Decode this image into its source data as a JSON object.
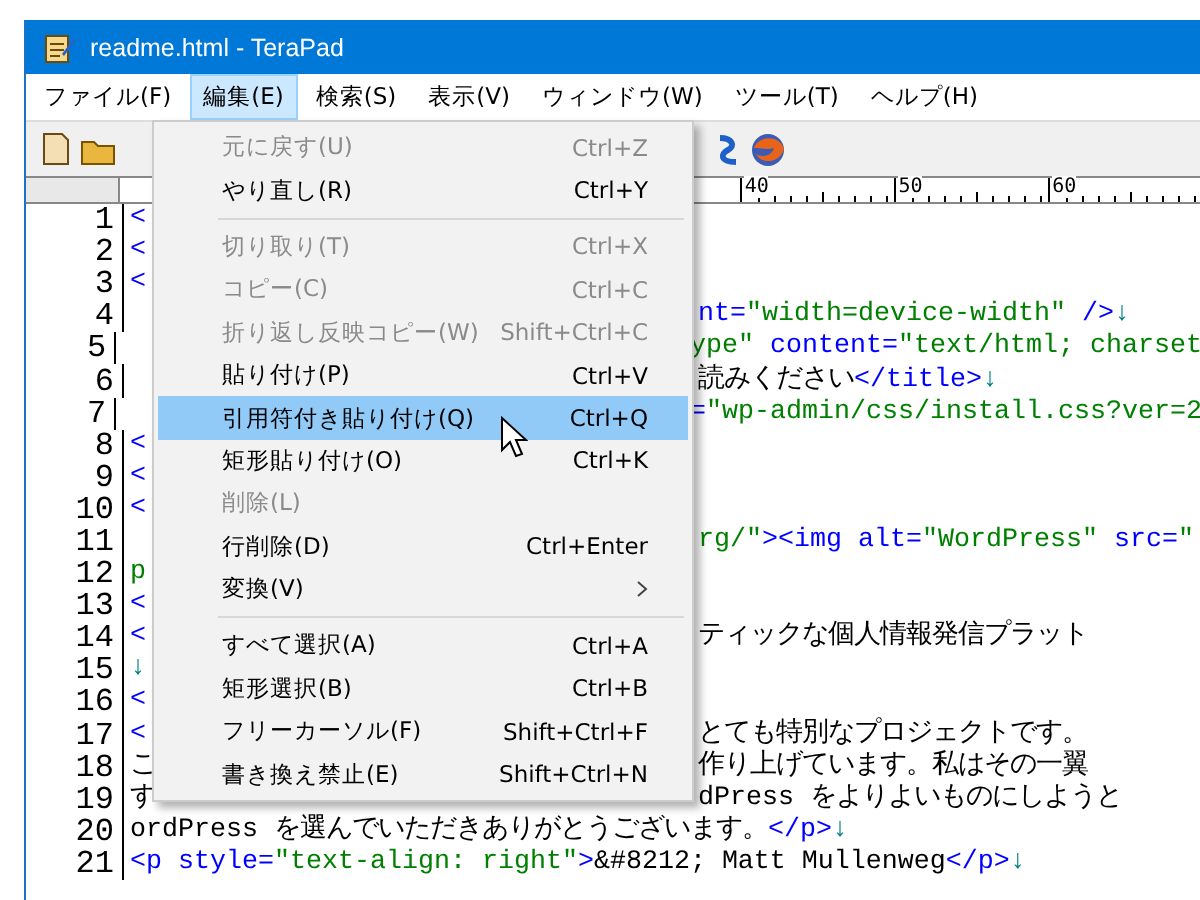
{
  "window": {
    "title": "readme.html - TeraPad"
  },
  "menu_bar": [
    {
      "label": "ファイル(F)",
      "selected": false
    },
    {
      "label": "編集(E)",
      "selected": true
    },
    {
      "label": "検索(S)",
      "selected": false
    },
    {
      "label": "表示(V)",
      "selected": false
    },
    {
      "label": "ウィンドウ(W)",
      "selected": false
    },
    {
      "label": "ツール(T)",
      "selected": false
    },
    {
      "label": "ヘルプ(H)",
      "selected": false
    }
  ],
  "ruler": [
    "40",
    "50",
    "60"
  ],
  "editor": {
    "lines": [
      {
        "number": "1",
        "left": [
          {
            "kind": "tag",
            "text": "<"
          }
        ]
      },
      {
        "number": "2",
        "left": [
          {
            "kind": "tag",
            "text": "<"
          }
        ]
      },
      {
        "number": "3",
        "left": [
          {
            "kind": "tag",
            "text": "<"
          }
        ]
      },
      {
        "number": "4",
        "right": [
          {
            "kind": "tag",
            "text": "nt="
          },
          {
            "kind": "value",
            "text": "\"width=device-width\""
          },
          {
            "kind": "tag",
            "text": " />"
          },
          {
            "kind": "mark",
            "text": "↓"
          }
        ]
      },
      {
        "number": "5",
        "right": [
          {
            "kind": "value",
            "text": "ype\""
          },
          {
            "kind": "tag",
            "text": " content="
          },
          {
            "kind": "value",
            "text": "\"text/html; charset"
          }
        ]
      },
      {
        "number": "6",
        "right": [
          {
            "kind": "text",
            "text": "読みください"
          },
          {
            "kind": "tag",
            "text": "</title>"
          },
          {
            "kind": "mark",
            "text": "↓"
          }
        ]
      },
      {
        "number": "7",
        "right": [
          {
            "kind": "tag",
            "text": "="
          },
          {
            "kind": "value",
            "text": "\"wp-admin/css/install.css?ver=2"
          }
        ]
      },
      {
        "number": "8",
        "left": [
          {
            "kind": "tag",
            "text": "<"
          }
        ]
      },
      {
        "number": "9",
        "left": [
          {
            "kind": "tag",
            "text": "<"
          }
        ]
      },
      {
        "number": "10",
        "left": [
          {
            "kind": "tag",
            "text": "<"
          }
        ]
      },
      {
        "number": "11",
        "right": [
          {
            "kind": "value",
            "text": "rg/\""
          },
          {
            "kind": "tag",
            "text": "><img alt="
          },
          {
            "kind": "value",
            "text": "\"WordPress\""
          },
          {
            "kind": "tag",
            "text": " src="
          },
          {
            "kind": "value",
            "text": "\""
          }
        ]
      },
      {
        "number": "12",
        "left": [
          {
            "kind": "value",
            "text": "p"
          }
        ]
      },
      {
        "number": "13",
        "left": [
          {
            "kind": "tag",
            "text": "<"
          }
        ]
      },
      {
        "number": "14",
        "left": [
          {
            "kind": "tag",
            "text": "<"
          }
        ],
        "right": [
          {
            "kind": "text",
            "text": "ティックな個人情報発信プラット"
          }
        ]
      },
      {
        "number": "15",
        "left": [
          {
            "kind": "mark",
            "text": "↓"
          }
        ]
      },
      {
        "number": "16",
        "left": [
          {
            "kind": "tag",
            "text": "<"
          }
        ]
      },
      {
        "number": "17",
        "left": [
          {
            "kind": "tag",
            "text": "<"
          }
        ],
        "right": [
          {
            "kind": "text",
            "text": "とても特別なプロジェクトです。"
          }
        ]
      },
      {
        "number": "18",
        "left": [
          {
            "kind": "text",
            "text": "こ"
          }
        ],
        "right": [
          {
            "kind": "text",
            "text": "作り上げています。私はその一翼"
          }
        ]
      },
      {
        "number": "19",
        "left": [
          {
            "kind": "text",
            "text": "す"
          }
        ],
        "right": [
          {
            "kind": "text",
            "text": "dPress をよりよいものにしようと"
          }
        ]
      },
      {
        "number": "20",
        "full": [
          {
            "kind": "text",
            "text": "ordPress を選んでいただきありがとうございます。"
          },
          {
            "kind": "tag",
            "text": "</p>"
          },
          {
            "kind": "mark",
            "text": "↓"
          }
        ]
      },
      {
        "number": "21",
        "full": [
          {
            "kind": "tag",
            "text": "<p style="
          },
          {
            "kind": "value",
            "text": "\"text-align: right\""
          },
          {
            "kind": "tag",
            "text": ">"
          },
          {
            "kind": "text",
            "text": "&#8212; Matt Mullenweg"
          },
          {
            "kind": "tag",
            "text": "</p>"
          },
          {
            "kind": "mark",
            "text": "↓"
          }
        ]
      }
    ]
  },
  "edit_menu": {
    "items": [
      {
        "kind": "command",
        "label": "元に戻す(U)",
        "shortcut": "Ctrl+Z",
        "disabled": true,
        "selected": false
      },
      {
        "kind": "command",
        "label": "やり直し(R)",
        "shortcut": "Ctrl+Y",
        "disabled": false,
        "selected": false
      },
      {
        "kind": "separator"
      },
      {
        "kind": "command",
        "label": "切り取り(T)",
        "shortcut": "Ctrl+X",
        "disabled": true,
        "selected": false
      },
      {
        "kind": "command",
        "label": "コピー(C)",
        "shortcut": "Ctrl+C",
        "disabled": true,
        "selected": false
      },
      {
        "kind": "command",
        "label": "折り返し反映コピー(W)",
        "shortcut": "Shift+Ctrl+C",
        "disabled": true,
        "selected": false
      },
      {
        "kind": "command",
        "label": "貼り付け(P)",
        "shortcut": "Ctrl+V",
        "disabled": false,
        "selected": false
      },
      {
        "kind": "command",
        "label": "引用符付き貼り付け(Q)",
        "shortcut": "Ctrl+Q",
        "disabled": false,
        "selected": true
      },
      {
        "kind": "command",
        "label": "矩形貼り付け(O)",
        "shortcut": "Ctrl+K",
        "disabled": false,
        "selected": false
      },
      {
        "kind": "command",
        "label": "削除(L)",
        "disabled": true,
        "selected": false
      },
      {
        "kind": "command",
        "label": "行削除(D)",
        "shortcut": "Ctrl+Enter",
        "disabled": false,
        "selected": false
      },
      {
        "kind": "submenu",
        "label": "変換(V)",
        "disabled": false,
        "selected": false
      },
      {
        "kind": "separator"
      },
      {
        "kind": "command",
        "label": "すべて選択(A)",
        "shortcut": "Ctrl+A",
        "disabled": false,
        "selected": false
      },
      {
        "kind": "command",
        "label": "矩形選択(B)",
        "shortcut": "Ctrl+B",
        "disabled": false,
        "selected": false
      },
      {
        "kind": "command",
        "label": "フリーカーソル(F)",
        "shortcut": "Shift+Ctrl+F",
        "disabled": false,
        "selected": false
      },
      {
        "kind": "command",
        "label": "書き換え禁止(E)",
        "shortcut": "Shift+Ctrl+N",
        "disabled": false,
        "selected": false
      }
    ]
  }
}
